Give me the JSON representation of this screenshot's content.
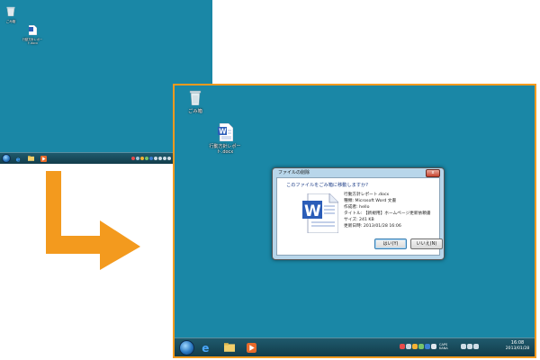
{
  "desktop": {
    "recycle_bin_label": "ごみ箱",
    "document_label_line1": "行動方針レポー",
    "document_label_line2": "ト.docx"
  },
  "dialog": {
    "title": "ファイルの削除",
    "close_glyph": "x",
    "question": "このファイルをごみ箱に移動しますか?",
    "file_name": "行動方針レポート.docx",
    "file_type": "種類: Microsoft Word 文書",
    "author": "作成者: hello",
    "file_title": "タイトル: 【新規用】ホームページ更新依頼書",
    "size": "サイズ: 241 KB",
    "modified": "更新日時: 2013/01/28 16:06",
    "yes_label": "はい(Y)",
    "no_label": "いいえ(N)"
  },
  "taskbar": {
    "clock_time": "16:08",
    "clock_date": "2013/01/28",
    "tray_text": "CAPS KANA"
  },
  "colors": {
    "desktop": "#1a87a6",
    "arrow": "#f39a1e",
    "frame": "#f39a1e"
  },
  "icons": [
    "recycle-bin-icon",
    "word-document-icon",
    "start-orb-icon",
    "ie-icon",
    "explorer-icon",
    "media-player-icon"
  ]
}
